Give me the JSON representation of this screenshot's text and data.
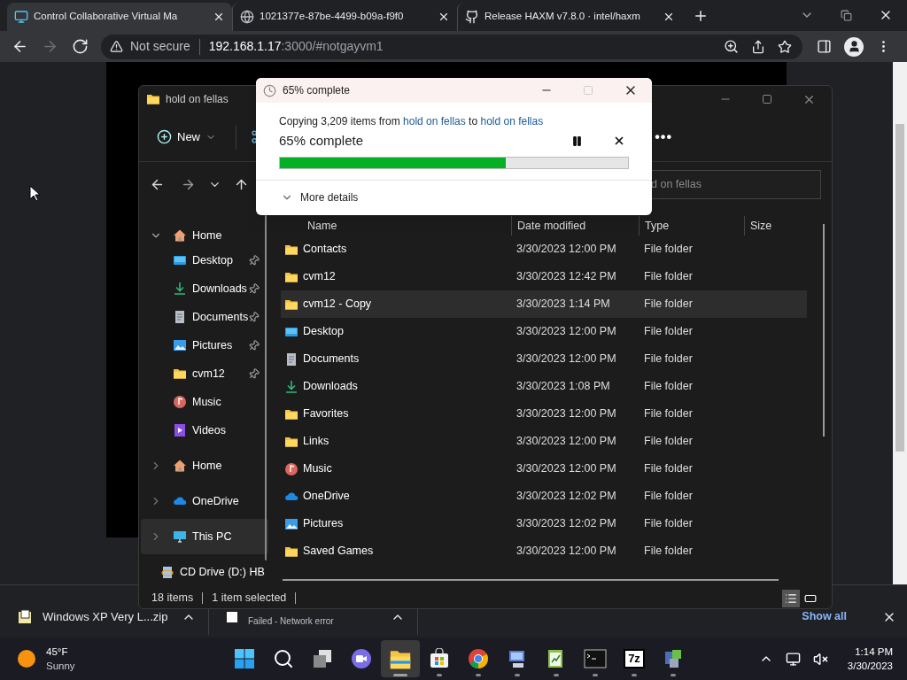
{
  "browser": {
    "tabs": [
      {
        "title": "Control Collaborative Virtual Ma",
        "kind": "monitor",
        "selected": true
      },
      {
        "title": "1021377e-87be-4499-b09a-f9f0",
        "kind": "globe",
        "selected": false
      },
      {
        "title": "Release HAXM v7.8.0 · intel/haxm",
        "kind": "github",
        "selected": false
      }
    ],
    "nav": [
      {
        "kind": "back",
        "disabled": false
      },
      {
        "kind": "forward",
        "disabled": true
      },
      {
        "kind": "reload",
        "disabled": false
      }
    ],
    "security": "Not secure",
    "url_host": "192.168.1.17",
    "url_rest": ":3000/#notgayvm1"
  },
  "explorer": {
    "title": "hold on fellas",
    "new_label": "New",
    "more_label": "•••",
    "search_text": "d on fellas",
    "sidebar": [
      {
        "label": "Home",
        "kind": "home",
        "expanded": true,
        "selected": false,
        "children": [
          {
            "label": "Desktop",
            "kind": "desktop",
            "pinned": true
          },
          {
            "label": "Downloads",
            "kind": "downloads",
            "pinned": true
          },
          {
            "label": "Documents",
            "kind": "documents",
            "pinned": true
          },
          {
            "label": "Pictures",
            "kind": "pictures",
            "pinned": true
          },
          {
            "label": "cvm12",
            "kind": "folder",
            "pinned": true
          },
          {
            "label": "Music",
            "kind": "music",
            "pinned": false
          },
          {
            "label": "Videos",
            "kind": "videos",
            "pinned": false
          }
        ]
      },
      {
        "label": "Home",
        "kind": "home",
        "expanded": false,
        "selected": false
      },
      {
        "label": "OneDrive",
        "kind": "onedrive",
        "expanded": false,
        "selected": false
      },
      {
        "label": "This PC",
        "kind": "pc",
        "expanded": false,
        "selected": true
      },
      {
        "label": "CD Drive (D:) HB",
        "kind": "cd",
        "expanded": false,
        "selected": false
      }
    ],
    "columns": [
      "Name",
      "Date modified",
      "Type",
      "Size"
    ],
    "rows": [
      {
        "name": "Contacts",
        "kind": "folder",
        "date": "3/30/2023 12:00 PM",
        "type": "File folder",
        "selected": false
      },
      {
        "name": "cvm12",
        "kind": "folder",
        "date": "3/30/2023 12:42 PM",
        "type": "File folder",
        "selected": false
      },
      {
        "name": "cvm12 - Copy",
        "kind": "folder",
        "date": "3/30/2023 1:14 PM",
        "type": "File folder",
        "selected": true
      },
      {
        "name": "Desktop",
        "kind": "desktop",
        "date": "3/30/2023 12:00 PM",
        "type": "File folder",
        "selected": false
      },
      {
        "name": "Documents",
        "kind": "documents",
        "date": "3/30/2023 12:00 PM",
        "type": "File folder",
        "selected": false
      },
      {
        "name": "Downloads",
        "kind": "downloads",
        "date": "3/30/2023 1:08 PM",
        "type": "File folder",
        "selected": false
      },
      {
        "name": "Favorites",
        "kind": "folder",
        "date": "3/30/2023 12:00 PM",
        "type": "File folder",
        "selected": false
      },
      {
        "name": "Links",
        "kind": "folder",
        "date": "3/30/2023 12:00 PM",
        "type": "File folder",
        "selected": false
      },
      {
        "name": "Music",
        "kind": "music",
        "date": "3/30/2023 12:00 PM",
        "type": "File folder",
        "selected": false
      },
      {
        "name": "OneDrive",
        "kind": "onedrive",
        "date": "3/30/2023 12:02 PM",
        "type": "File folder",
        "selected": false
      },
      {
        "name": "Pictures",
        "kind": "pictures",
        "date": "3/30/2023 12:02 PM",
        "type": "File folder",
        "selected": false
      },
      {
        "name": "Saved Games",
        "kind": "folder",
        "date": "3/30/2023 12:00 PM",
        "type": "File folder",
        "selected": false
      }
    ],
    "status": [
      "18 items",
      "1 item selected"
    ],
    "views": [
      {
        "kind": "details",
        "selected": true
      },
      {
        "kind": "tiles",
        "selected": false
      }
    ]
  },
  "copy_dialog": {
    "title": "65% complete",
    "message": "Copying 3,209 items from ",
    "source": "hold on fellas",
    "joiner": " to ",
    "destination": "hold on fellas",
    "heading": "65% complete",
    "level": 0.65,
    "details_label": "More details",
    "maximize_disabled": true
  },
  "downloads": {
    "items": [
      {
        "name": "Windows XP Very L...zip",
        "kind": "archive"
      },
      {
        "status": "Failed - Network error",
        "kind": "failed"
      }
    ],
    "show_all": "Show all"
  },
  "taskbar": {
    "weather": {
      "temp": "45°F",
      "condition": "Sunny"
    },
    "apps": [
      {
        "kind": "start",
        "running": false,
        "selected": false
      },
      {
        "kind": "search",
        "running": false,
        "selected": false
      },
      {
        "kind": "taskview",
        "running": false,
        "selected": false
      },
      {
        "kind": "chat",
        "running": false,
        "selected": false
      },
      {
        "kind": "explorer",
        "running": true,
        "selected": true
      },
      {
        "kind": "store",
        "running": true,
        "selected": false
      },
      {
        "kind": "chrome",
        "running": true,
        "selected": false
      },
      {
        "kind": "remote",
        "running": true,
        "selected": false
      },
      {
        "kind": "notepad",
        "running": true,
        "selected": false
      },
      {
        "kind": "terminal",
        "running": true,
        "selected": false
      },
      {
        "kind": "archiver",
        "label": "7z",
        "running": true,
        "selected": false
      },
      {
        "kind": "installer",
        "running": true,
        "selected": false
      }
    ],
    "time": "1:14 PM",
    "date": "3/30/2023"
  }
}
